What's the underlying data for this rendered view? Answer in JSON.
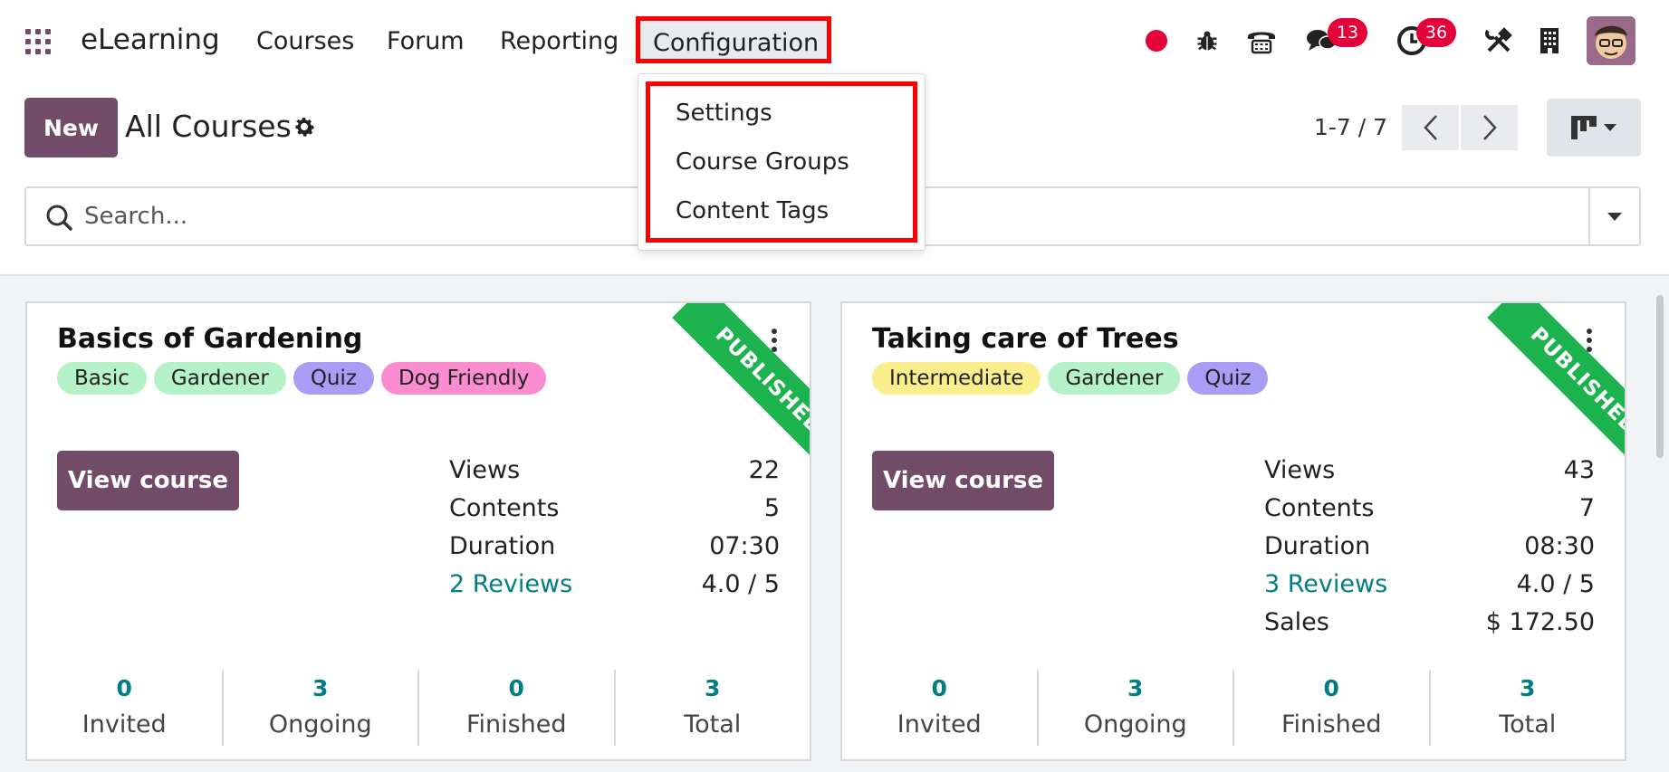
{
  "app": {
    "name": "eLearning"
  },
  "nav": {
    "items": [
      "Courses",
      "Forum",
      "Reporting"
    ],
    "active": "Configuration"
  },
  "systray": {
    "messages_count": "13",
    "activities_count": "36"
  },
  "dropdown": {
    "items": [
      "Settings",
      "Course Groups",
      "Content Tags"
    ]
  },
  "control": {
    "new_label": "New",
    "title": "All Courses",
    "pager": "1-7 / 7"
  },
  "search": {
    "placeholder": "Search..."
  },
  "colors": {
    "brand": "#714b67",
    "published": "#1cb34e",
    "link": "#017e84",
    "highlight": "#ff0000",
    "badge": "#e6003a"
  },
  "cards": [
    {
      "title": "Basics of Gardening",
      "ribbon": "PUBLISHED",
      "tags": [
        {
          "label": "Basic",
          "color": "#b5f2c8"
        },
        {
          "label": "Gardener",
          "color": "#b5f2c8"
        },
        {
          "label": "Quiz",
          "color": "#a99cf5"
        },
        {
          "label": "Dog Friendly",
          "color": "#fb8cd0"
        }
      ],
      "button": "View course",
      "stats": [
        {
          "label": "Views",
          "value": "22"
        },
        {
          "label": "Contents",
          "value": "5"
        },
        {
          "label": "Duration",
          "value": "07:30"
        },
        {
          "label": "2 Reviews",
          "value": "4.0 / 5",
          "link": true
        }
      ],
      "counters": [
        {
          "num": "0",
          "label": "Invited"
        },
        {
          "num": "3",
          "label": "Ongoing"
        },
        {
          "num": "0",
          "label": "Finished"
        },
        {
          "num": "3",
          "label": "Total"
        }
      ]
    },
    {
      "title": "Taking care of Trees",
      "ribbon": "PUBLISHED",
      "tags": [
        {
          "label": "Intermediate",
          "color": "#f9ee8b"
        },
        {
          "label": "Gardener",
          "color": "#b5f2c8"
        },
        {
          "label": "Quiz",
          "color": "#a99cf5"
        }
      ],
      "button": "View course",
      "stats": [
        {
          "label": "Views",
          "value": "43"
        },
        {
          "label": "Contents",
          "value": "7"
        },
        {
          "label": "Duration",
          "value": "08:30"
        },
        {
          "label": "3 Reviews",
          "value": "4.0 / 5",
          "link": true
        },
        {
          "label": "Sales",
          "value": "$ 172.50"
        }
      ],
      "counters": [
        {
          "num": "0",
          "label": "Invited"
        },
        {
          "num": "3",
          "label": "Ongoing"
        },
        {
          "num": "0",
          "label": "Finished"
        },
        {
          "num": "3",
          "label": "Total"
        }
      ]
    }
  ]
}
